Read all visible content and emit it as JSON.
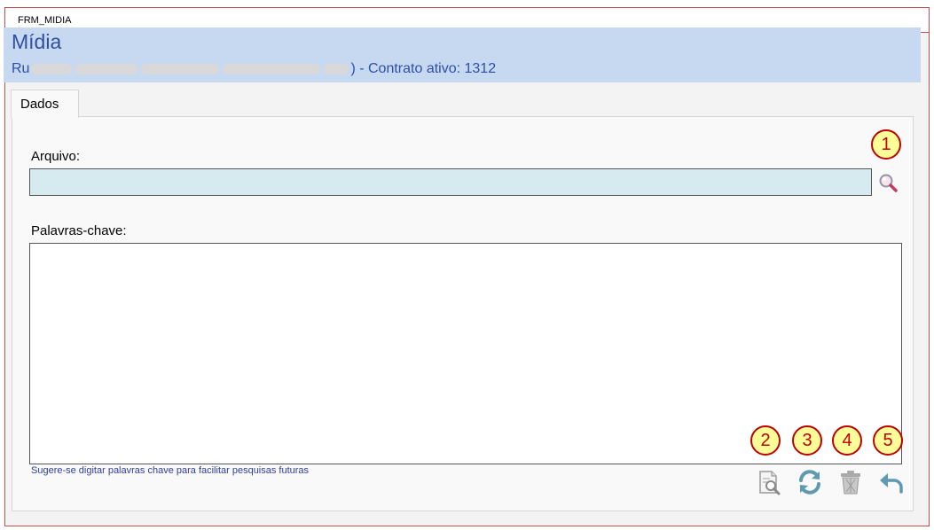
{
  "window": {
    "title": "FRM_MIDIA"
  },
  "header": {
    "title": "Mídia",
    "subtitle_prefix": "Ru",
    "subtitle_suffix": ") - Contrato ativo: 1312"
  },
  "tabs": [
    {
      "label": "Dados"
    }
  ],
  "form": {
    "file_label": "Arquivo:",
    "file_value": "",
    "keywords_label": "Palavras-chave:",
    "keywords_value": "",
    "hint": "Sugere-se digitar palavras chave para facilitar pesquisas futuras"
  },
  "callouts": [
    "1",
    "2",
    "3",
    "4",
    "5"
  ],
  "icons": {
    "browse": "magnifier-icon",
    "preview": "document-preview-icon",
    "refresh": "refresh-icon",
    "delete": "trash-icon",
    "back": "undo-arrow-icon"
  },
  "colors": {
    "header_bg": "#c6d9f1",
    "header_text": "#2f4fa6",
    "file_field_bg": "#d6ebf0",
    "callout_fill": "#ffff99",
    "callout_border": "#c00000",
    "window_border": "#c0504d"
  }
}
